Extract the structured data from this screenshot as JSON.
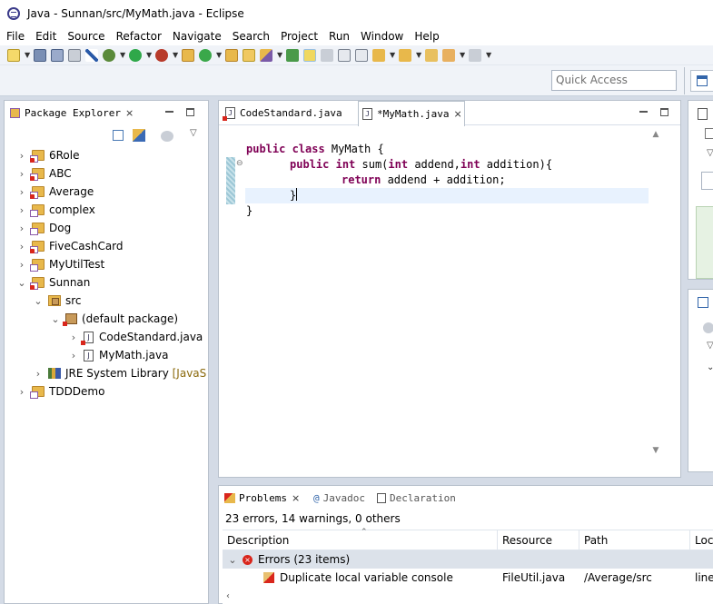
{
  "window": {
    "title": "Java - Sunnan/src/MyMath.java - Eclipse"
  },
  "menu": [
    "File",
    "Edit",
    "Source",
    "Refactor",
    "Navigate",
    "Search",
    "Project",
    "Run",
    "Window",
    "Help"
  ],
  "quick_access": {
    "placeholder": "Quick Access"
  },
  "package_explorer": {
    "tab_label": "Package Explorer",
    "projects": [
      {
        "label": "6Role"
      },
      {
        "label": "ABC"
      },
      {
        "label": "Average"
      },
      {
        "label": "complex"
      },
      {
        "label": "Dog"
      },
      {
        "label": "FiveCashCard"
      },
      {
        "label": "MyUtilTest"
      },
      {
        "label": "Sunnan"
      },
      {
        "label": "src"
      },
      {
        "label": "(default package)"
      },
      {
        "label": "CodeStandard.java"
      },
      {
        "label": "MyMath.java"
      },
      {
        "label": "JRE System Library",
        "suffix": "[JavaS"
      },
      {
        "label": "TDDDemo"
      }
    ]
  },
  "editor": {
    "tabs": [
      {
        "label": "CodeStandard.java"
      },
      {
        "label": "*MyMath.java"
      }
    ],
    "code": {
      "l1_kw": "public class",
      "l1_rest": " MyMath {",
      "l2_kw1": "public",
      "l2_mid1": " ",
      "l2_kw2": "int",
      "l2_mid2": " sum(",
      "l2_kw3": "int",
      "l2_mid3": " addend,",
      "l2_kw4": "int",
      "l2_rest": " addition){",
      "l3_kw": "return",
      "l3_rest": " addend + addition;",
      "l4": "}",
      "l5": "}"
    }
  },
  "problems": {
    "tabs": [
      {
        "label": "Problems"
      },
      {
        "label": "Javadoc"
      },
      {
        "label": "Declaration"
      }
    ],
    "summary": "23 errors, 14 warnings, 0 others",
    "columns": [
      "Description",
      "Resource",
      "Path",
      "Loca"
    ],
    "group": "Errors (23 items)",
    "rows": [
      {
        "description": "Duplicate local variable console",
        "resource": "FileUtil.java",
        "path": "/Average/src",
        "location": "line"
      }
    ]
  },
  "colors": {
    "keyword": "#7f0055",
    "accent": "#3366aa",
    "error": "#d9261c"
  }
}
